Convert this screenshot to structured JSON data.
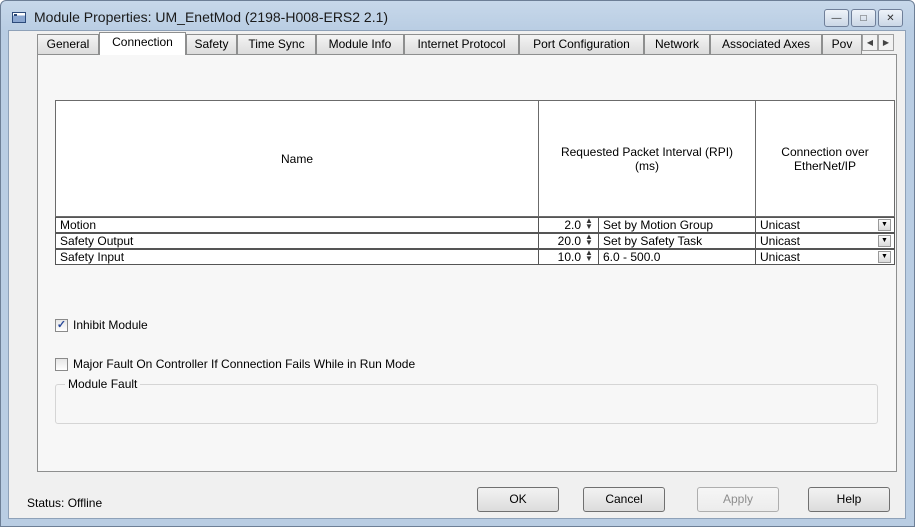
{
  "window": {
    "title": "Module Properties: UM_EnetMod (2198-H008-ERS2 2.1)"
  },
  "tabs": [
    {
      "label": "General"
    },
    {
      "label": "Connection"
    },
    {
      "label": "Safety"
    },
    {
      "label": "Time Sync"
    },
    {
      "label": "Module Info"
    },
    {
      "label": "Internet Protocol"
    },
    {
      "label": "Port Configuration"
    },
    {
      "label": "Network"
    },
    {
      "label": "Associated Axes"
    },
    {
      "label": "Pov"
    }
  ],
  "active_tab": "Connection",
  "table": {
    "headers": {
      "name": "Name",
      "rpi": "Requested Packet Interval (RPI) (ms)",
      "conn": "Connection over EtherNet/IP"
    },
    "rows": [
      {
        "name": "Motion",
        "rpi": "2.0",
        "note": "Set by Motion Group",
        "conn": "Unicast"
      },
      {
        "name": "Safety Output",
        "rpi": "20.0",
        "note": "Set by Safety Task",
        "conn": "Unicast"
      },
      {
        "name": "Safety Input",
        "rpi": "10.0",
        "note": "6.0 - 500.0",
        "conn": "Unicast"
      }
    ]
  },
  "options": {
    "inhibit_module": {
      "label": "Inhibit Module",
      "checked": true
    },
    "major_fault": {
      "label": "Major Fault On Controller If Connection Fails While in Run Mode",
      "checked": false
    }
  },
  "module_fault": {
    "label": "Module Fault"
  },
  "status": {
    "text": "Status:  Offline"
  },
  "buttons": {
    "ok": "OK",
    "cancel": "Cancel",
    "apply": "Apply",
    "help": "Help"
  }
}
